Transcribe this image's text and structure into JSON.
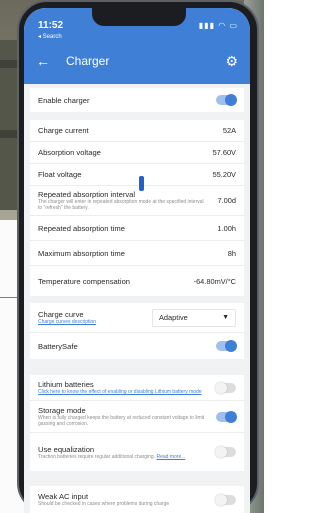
{
  "status_bar": {
    "time": "11:52",
    "back_app": "◂ Search"
  },
  "header": {
    "title": "Charger"
  },
  "colors": {
    "accent": "#3f7fd6",
    "header_bg": "#3f7fd6",
    "page_bg": "#f1f2f4"
  },
  "settings": {
    "enable_charger": {
      "label": "Enable charger",
      "on": true
    },
    "charge_current": {
      "label": "Charge current",
      "value": "52A"
    },
    "absorption_voltage": {
      "label": "Absorption voltage",
      "value": "57.60V"
    },
    "float_voltage": {
      "label": "Float voltage",
      "value": "55.20V"
    },
    "repeated_absorption_interval": {
      "label": "Repeated absorption interval",
      "description": "The charger will enter in repeated absorption mode at the specified interval to \"refresh\" the battery.",
      "value": "7.00d"
    },
    "repeated_absorption_time": {
      "label": "Repeated absorption time",
      "value": "1.00h"
    },
    "maximum_absorption_time": {
      "label": "Maximum absorption time",
      "value": "8h"
    },
    "temperature_compensation": {
      "label": "Temperature compensation",
      "value": "-64.80mV/°C"
    }
  },
  "charge_curve": {
    "label": "Charge curve",
    "link": "Charge curves description",
    "selected": "Adaptive"
  },
  "battery_safe": {
    "label": "BatterySafe",
    "on": true
  },
  "lithium": {
    "label": "Lithium batteries",
    "link": "Click here to know the effect of enabling or disabling Lithium battery mode",
    "on": false
  },
  "storage_mode": {
    "label": "Storage mode",
    "description": "When is fully charged keeps the battery at reduced constant voltage to limit gassing and corrosion.",
    "on": true
  },
  "equalization": {
    "label": "Use equalization",
    "description": "Traction batteries require regular additional charging.",
    "link": "Read more...",
    "on": false
  },
  "weak_ac": {
    "label": "Weak AC input",
    "description": "Should be checked in cases where problems during charge",
    "on": false
  }
}
